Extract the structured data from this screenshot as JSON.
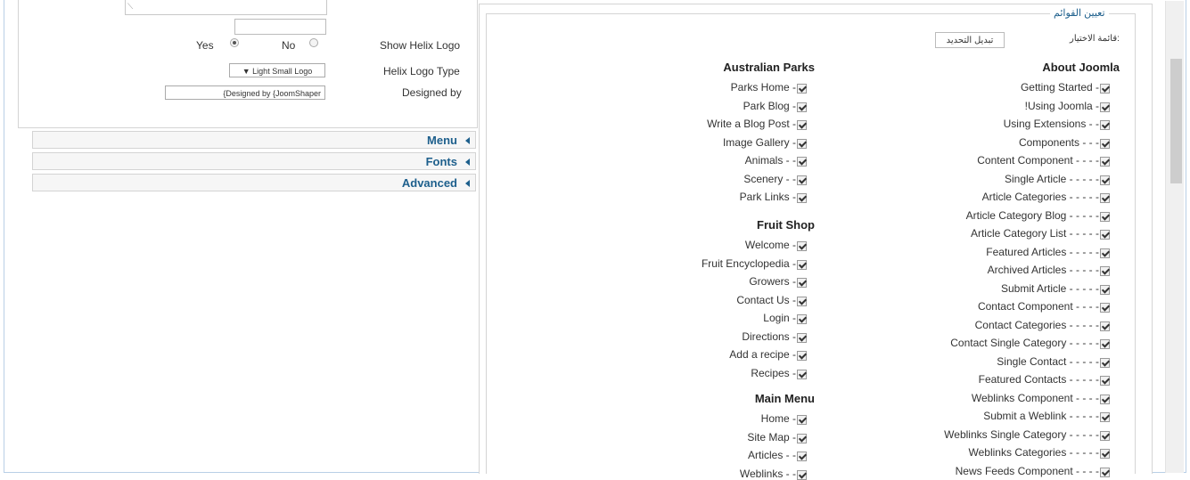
{
  "params": {
    "show_helix_logo_label": "Show Helix Logo",
    "yes_label": "Yes",
    "no_label": "No",
    "show_helix_logo_value": "Yes",
    "logo_type_label": "Helix Logo Type",
    "logo_type_value": "▼  Light Small Logo",
    "designed_by_label": "Designed by",
    "designed_by_value": "{Designed by {JoomShaper"
  },
  "accordion": [
    {
      "label": "Menu"
    },
    {
      "label": "Fonts"
    },
    {
      "label": "Advanced"
    }
  ],
  "menu_assign": {
    "legend": "تعيين القوائم",
    "select_label": "قائمة الاختيار:",
    "toggle_button": "تبديل التحديد",
    "right_column": {
      "heading": "About Joomla",
      "items": [
        "Getting Started -",
        "!Using Joomla -",
        "Using Extensions - -",
        "Components - - -",
        "Content Component - - - -",
        "Single Article - - - - -",
        "Article Categories - - - - -",
        "Article Category Blog - - - - -",
        "Article Category List - - - - -",
        "Featured Articles - - - - -",
        "Archived Articles - - - - -",
        "Submit Article - - - - -",
        "Contact Component - - - -",
        "Contact Categories - - - - -",
        "Contact Single Category - - - - -",
        "Single Contact - - - - -",
        "Featured Contacts - - - - -",
        "Weblinks Component - - - -",
        "Submit a Weblink - - - - -",
        "Weblinks Single Category - - - - -",
        "Weblinks Categories - - - - -",
        "News Feeds Component - - - -"
      ]
    },
    "left_groups": [
      {
        "heading": "Australian Parks",
        "items": [
          "Parks Home -",
          "Park Blog -",
          "Write a Blog Post -",
          "Image Gallery -",
          "Animals - -",
          "Scenery - -",
          "Park Links -"
        ]
      },
      {
        "heading": "Fruit Shop",
        "items": [
          "Welcome -",
          "Fruit Encyclopedia -",
          "Growers -",
          "Contact Us -",
          "Login -",
          "Directions -",
          "Add a recipe -",
          "Recipes -"
        ]
      },
      {
        "heading": "Main Menu",
        "items": [
          "Home -",
          "Site Map -",
          "Articles - -",
          "Weblinks - -"
        ]
      }
    ]
  }
}
